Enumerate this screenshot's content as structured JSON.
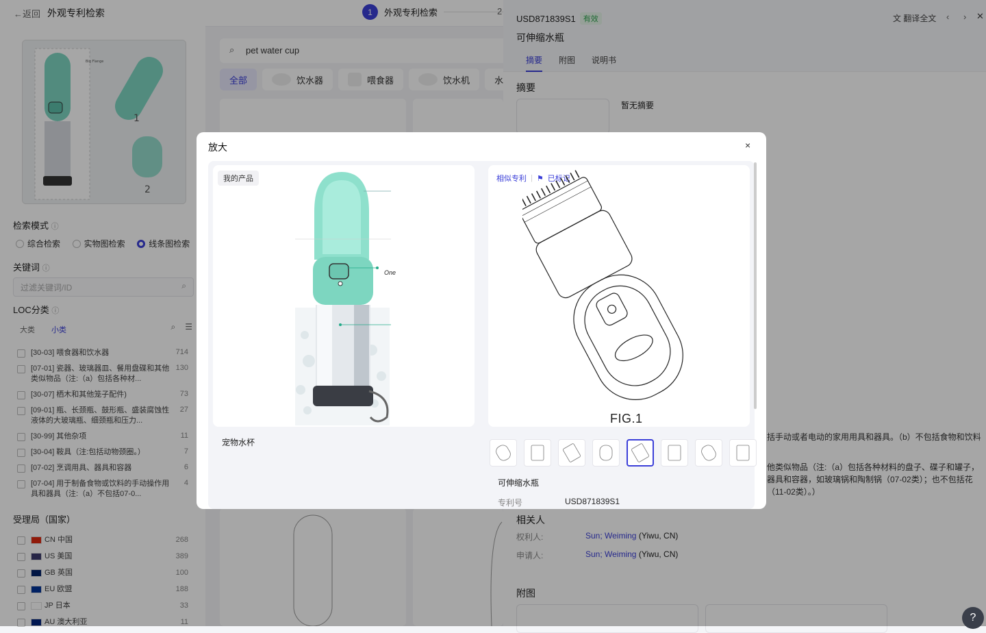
{
  "header": {
    "back_label": "返回",
    "title": "外观专利检索",
    "step1_num": "1",
    "step1_label": "外观专利检索",
    "step2_num": "2"
  },
  "sidebar": {
    "search_mode_label": "检索模式",
    "modes": [
      "综合检索",
      "实物图检索",
      "线条图检索"
    ],
    "selected_mode": "线条图检索",
    "keyword_label": "关键词",
    "keyword_placeholder": "过滤关键词/ID",
    "loc_label": "LOC分类",
    "loc_tabs": [
      "大类",
      "小类"
    ],
    "loc_items": [
      {
        "name": "[30-03] 喂食器和饮水器",
        "count": "714"
      },
      {
        "name": "[07-01] 瓷器、玻璃器皿、餐用盘碟和其他类似物品（注:（a）包括各种材...",
        "count": "130"
      },
      {
        "name": "[30-07] 栖木和其他笼子配件)",
        "count": "73"
      },
      {
        "name": "[09-01] 瓶、长颈瓶、鼓形瓶、盛装腐蚀性液体的大玻璃瓶、细颈瓶和压力...",
        "count": "27"
      },
      {
        "name": "[30-99] 其他杂项",
        "count": "11"
      },
      {
        "name": "[30-04] 鞍具（注:包括动物颈圈。）",
        "count": "7"
      },
      {
        "name": "[07-02] 烹调用具、器具和容器",
        "count": "6"
      },
      {
        "name": "[07-04] 用于制备食物或饮料的手动操作用具和器具（注:（a）不包括07-0...",
        "count": "4"
      }
    ],
    "office_label": "受理局（国家）",
    "offices": [
      {
        "name": "CN 中国",
        "count": "268",
        "flag": "#de2910"
      },
      {
        "name": "US 美国",
        "count": "389",
        "flag": "#3c3b6e"
      },
      {
        "name": "GB 英国",
        "count": "100",
        "flag": "#012169"
      },
      {
        "name": "EU 欧盟",
        "count": "188",
        "flag": "#003399"
      },
      {
        "name": "JP 日本",
        "count": "33",
        "flag": "#ffffff"
      },
      {
        "name": "AU 澳大利亚",
        "count": "11",
        "flag": "#00247d"
      }
    ]
  },
  "results": {
    "query": "pet water cup",
    "chips": [
      "全部",
      "饮水器",
      "喂食器",
      "饮水机",
      "水"
    ]
  },
  "detail": {
    "patent_no": "USD871839S1",
    "status": "有效",
    "title": "可伸缩水瓶",
    "translate_label": "翻译全文",
    "tabs": [
      "摘要",
      "附图",
      "说明书"
    ],
    "abstract_heading": "摘要",
    "no_abstract": "暂无摘要",
    "loc_text_1": "括手动或者电动的家用用具和器具。（b）不包括食物和饮料",
    "loc_text_2": "他类似物品（注:（a）包括各种材料的盘子、碟子和罐子，",
    "loc_text_3": "器具和容器，如玻璃锅和陶制锅（07-02类）；也不包括花",
    "loc_text_4": "（11-02类）。）",
    "people_heading": "相关人",
    "owner_label": "权利人:",
    "owner_name": "Sun; Weiming",
    "owner_loc": "(Yiwu, CN)",
    "applicant_label": "申请人:",
    "applicant_name": "Sun; Weiming",
    "applicant_loc": "(Yiwu, CN)",
    "drawings_heading": "附图"
  },
  "modal": {
    "title": "放大",
    "close_label": "×",
    "my_product_tag": "我的产品",
    "my_product_name": "宠物水杯",
    "similar_tag": "相似专利",
    "marked_tag": "已标记",
    "fig_label": "FIG.1",
    "patent_title": "可伸缩水瓶",
    "patent_no_label": "专利号",
    "patent_no_value": "USD871839S1",
    "product_annotation": "One",
    "selected_thumb_index": 4,
    "thumb_count": 8
  },
  "help_label": "?"
}
